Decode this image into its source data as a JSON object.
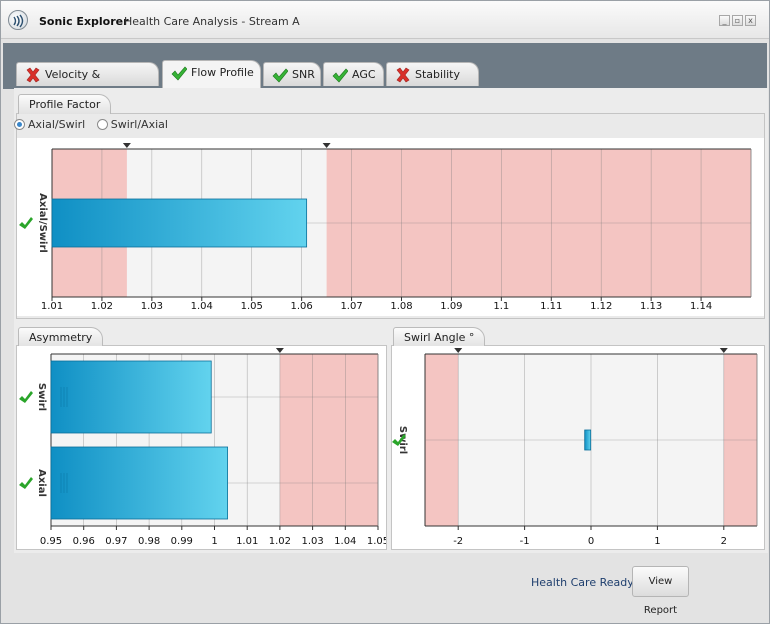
{
  "window": {
    "app_name": "Sonic Explorer",
    "title": "Health Care Analysis - Stream A",
    "controls": [
      "minimize",
      "restore",
      "close"
    ]
  },
  "tabs": [
    {
      "label": "Velocity & Performance",
      "status": "fail",
      "active": false
    },
    {
      "label": "Flow Profile",
      "status": "pass",
      "active": true
    },
    {
      "label": "SNR",
      "status": "pass",
      "active": false
    },
    {
      "label": "AGC",
      "status": "pass",
      "active": false
    },
    {
      "label": "Stability",
      "status": "fail",
      "active": false
    }
  ],
  "profile_factor": {
    "tab_label": "Profile Factor",
    "options": [
      {
        "label": "Axial/Swirl",
        "selected": true
      },
      {
        "label": "Swirl/Axial",
        "selected": false
      }
    ]
  },
  "asymmetry": {
    "tab_label": "Asymmetry"
  },
  "swirl_angle": {
    "tab_label": "Swirl Angle °"
  },
  "footer": {
    "status": "Health Care Ready",
    "report_button": "View Report"
  },
  "colors": {
    "pass": "#2aa52a",
    "fail": "#d9302b",
    "bar": "#1aa0d4",
    "alarm_band": "#f4c5c2"
  },
  "chart_data": [
    {
      "type": "bar",
      "orientation": "horizontal",
      "categories": [
        "Axial/Swirl"
      ],
      "values": [
        1.061
      ],
      "category_status": [
        "pass"
      ],
      "xlim": [
        1.01,
        1.15
      ],
      "x_ticks": [
        "1.01",
        "1.02",
        "1.03",
        "1.04",
        "1.05",
        "1.06",
        "1.07",
        "1.08",
        "1.09",
        "1.1",
        "1.11",
        "1.12",
        "1.13",
        "1.14"
      ],
      "alarm_bands": [
        [
          1.01,
          1.025
        ],
        [
          1.065,
          1.15
        ]
      ],
      "limit_markers": [
        1.025,
        1.065
      ],
      "grid": true
    },
    {
      "type": "bar",
      "orientation": "horizontal",
      "categories": [
        "Swirl",
        "Axial"
      ],
      "values": [
        0.999,
        1.004
      ],
      "category_status": [
        "pass",
        "pass"
      ],
      "xlim": [
        0.95,
        1.05
      ],
      "x_ticks": [
        "0.95",
        "0.96",
        "0.97",
        "0.98",
        "0.99",
        "1",
        "1.01",
        "1.02",
        "1.03",
        "1.04",
        "1.05"
      ],
      "alarm_bands": [
        [
          1.02,
          1.05
        ]
      ],
      "limit_markers": [
        1.02
      ],
      "grid": true
    },
    {
      "type": "bar",
      "orientation": "horizontal",
      "categories": [
        "Swirl"
      ],
      "values": [
        -0.05
      ],
      "category_status": [
        "pass"
      ],
      "xlim": [
        -2.5,
        2.5
      ],
      "x_ticks": [
        "-2",
        "-1",
        "0",
        "1",
        "2"
      ],
      "alarm_bands": [
        [
          -2.5,
          -2
        ],
        [
          2,
          2.5
        ]
      ],
      "limit_markers": [
        -2,
        2
      ],
      "grid": true
    }
  ]
}
